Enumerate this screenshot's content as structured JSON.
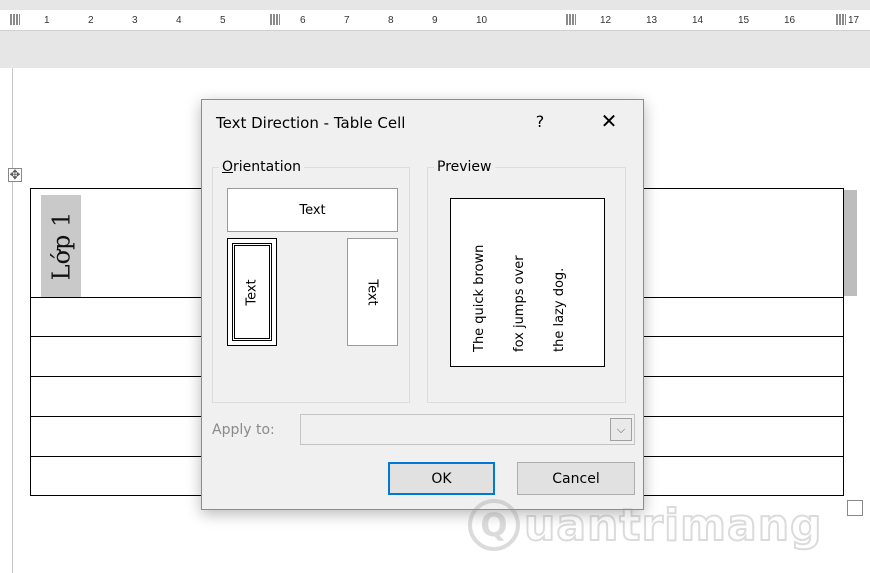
{
  "ruler": {
    "ticks": [
      "1",
      "2",
      "3",
      "4",
      "5",
      "6",
      "7",
      "8",
      "9",
      "10",
      "12",
      "13",
      "14",
      "15",
      "16",
      "17"
    ]
  },
  "document": {
    "cell_text": "Lớp 1"
  },
  "dialog": {
    "title": "Text Direction - Table Cell",
    "help": "?",
    "close": "✕",
    "orientation": {
      "label_accel": "O",
      "label_rest": "rientation",
      "options": [
        "Text",
        "Text",
        "Text"
      ]
    },
    "preview": {
      "label": "Preview",
      "lines": [
        "The quick brown",
        "fox jumps over",
        "the lazy dog."
      ]
    },
    "apply_to": {
      "label": "Apply to:",
      "value": ""
    },
    "ok": "OK",
    "cancel": "Cancel"
  },
  "watermark": {
    "letter": "Q",
    "text": "uantrimang"
  }
}
